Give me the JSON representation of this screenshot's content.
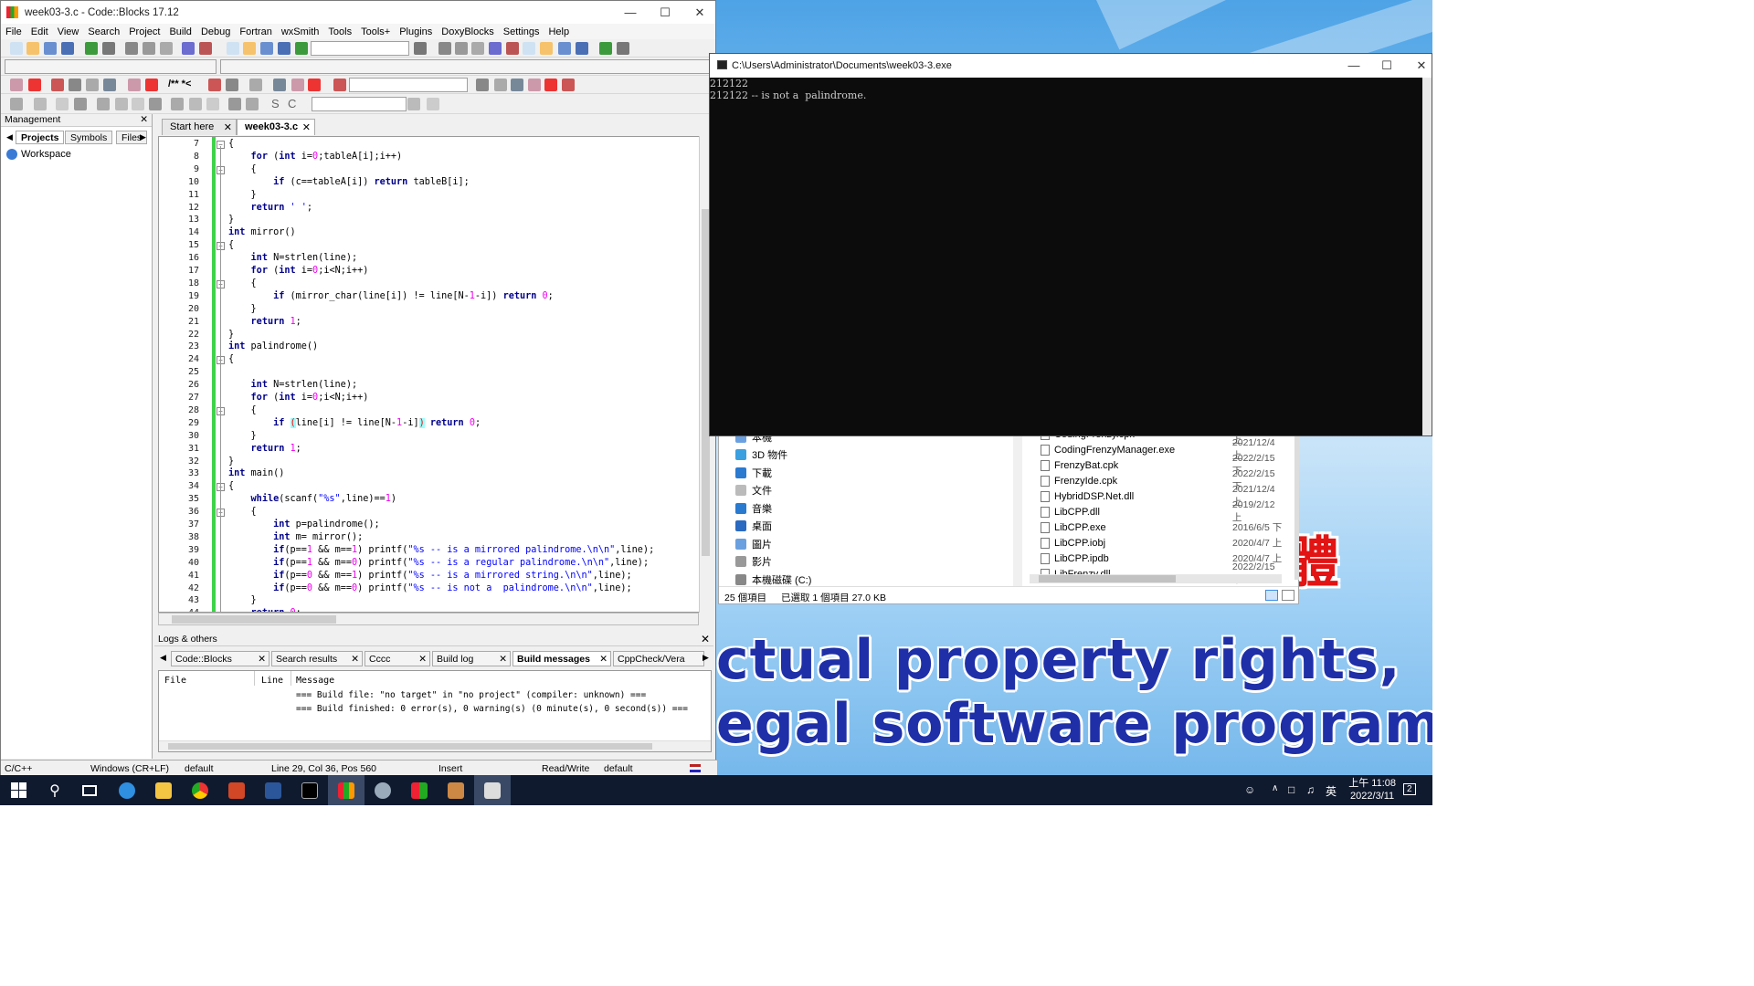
{
  "codeblocks": {
    "title": "week03-3.c - Code::Blocks 17.12",
    "menu": [
      "File",
      "Edit",
      "View",
      "Search",
      "Project",
      "Build",
      "Debug",
      "Fortran",
      "wxSmith",
      "Tools",
      "Tools+",
      "Plugins",
      "DoxyBlocks",
      "Settings",
      "Help"
    ],
    "toolbar_text": {
      "doxy": "/** *<",
      "s_label": "S",
      "c_label": "C"
    },
    "management": {
      "title": "Management",
      "tabs": [
        "Projects",
        "Symbols",
        "Files"
      ],
      "workspace": "Workspace"
    },
    "editor_tabs": [
      "Start here",
      "week03-3.c"
    ],
    "line_numbers": [
      "7",
      "8",
      "9",
      "10",
      "11",
      "12",
      "13",
      "14",
      "15",
      "16",
      "17",
      "18",
      "19",
      "20",
      "21",
      "22",
      "23",
      "24",
      "25",
      "26",
      "27",
      "28",
      "29",
      "30",
      "31",
      "32",
      "33",
      "34",
      "35",
      "36",
      "37",
      "38",
      "39",
      "40",
      "41",
      "42",
      "43",
      "44"
    ],
    "logs": {
      "title": "Logs & others",
      "tabs": [
        "Code::Blocks",
        "Search results",
        "Cccc",
        "Build log",
        "Build messages",
        "CppCheck/Vera"
      ],
      "columns": [
        "File",
        "Line",
        "Message"
      ],
      "messages": [
        "=== Build file: \"no target\" in \"no project\" (compiler: unknown) ===",
        "=== Build finished: 0 error(s), 0 warning(s) (0 minute(s), 0 second(s)) ==="
      ]
    },
    "statusbar": {
      "lang": "C/C++",
      "eol": "Windows (CR+LF)",
      "encoding": "default",
      "position": "Line 29, Col 36, Pos 560",
      "mode": "Insert",
      "access": "Read/Write",
      "profile": "default"
    }
  },
  "console": {
    "title": "C:\\Users\\Administrator\\Documents\\week03-3.exe",
    "lines": [
      "212122",
      "212122 -- is not a  palindrome."
    ]
  },
  "explorer": {
    "tree": [
      "本機",
      "3D 物件",
      "下載",
      "文件",
      "音樂",
      "桌面",
      "圖片",
      "影片",
      "本機磁碟 (C:)"
    ],
    "files": [
      {
        "name": "CodingFrenzy.cpk",
        "date": "2021/12/4 上"
      },
      {
        "name": "CodingFrenzyManager.exe",
        "date": "2021/12/4 上"
      },
      {
        "name": "FrenzyBat.cpk",
        "date": "2022/2/15 下"
      },
      {
        "name": "FrenzyIde.cpk",
        "date": "2022/2/15 下"
      },
      {
        "name": "HybridDSP.Net.dll",
        "date": "2021/12/4 上"
      },
      {
        "name": "LibCPP.dll",
        "date": "2019/2/12 上"
      },
      {
        "name": "LibCPP.exe",
        "date": "2016/6/5 下"
      },
      {
        "name": "LibCPP.iobj",
        "date": "2020/4/7 上"
      },
      {
        "name": "LibCPP.ipdb",
        "date": "2020/4/7 上"
      },
      {
        "name": "LibFrenzy.dll",
        "date": "2022/2/15 下"
      }
    ],
    "status_count": "25 個項目",
    "status_selected": "已選取 1 個項目  27.0 KB"
  },
  "background": {
    "line1": "ctual property rights,",
    "line2": "egal software programs”",
    "red_char": "體"
  },
  "taskbar": {
    "time": "上午 11:08",
    "date": "2022/3/11",
    "ime": "英",
    "notif": "2"
  }
}
